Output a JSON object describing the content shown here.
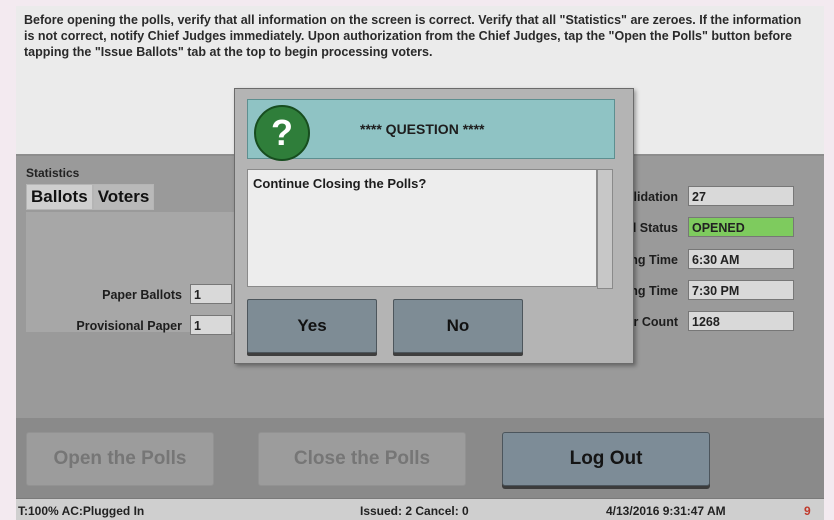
{
  "instructions": "Before opening the polls, verify that all information on the screen is correct. Verify that all \"Statistics\" are zeroes. If the information is not correct, notify Chief Judges immediately. Upon authorization from the Chief Judges, tap the \"Open the Polls\" button before tapping the \"Issue Ballots\" tab at the top to begin processing voters.",
  "statistics": {
    "label": "Statistics",
    "tabs": [
      "Ballots",
      "Voters"
    ],
    "fields": [
      {
        "label": "Paper Ballots",
        "value": "1"
      },
      {
        "label": "Provisional Paper",
        "value": "1"
      }
    ]
  },
  "right_fields": [
    {
      "label": "olidation",
      "value": "27"
    },
    {
      "label": "oll Status",
      "value": "OPENED"
    },
    {
      "label": "ing Time",
      "value": "6:30 AM"
    },
    {
      "label": "ing Time",
      "value": "7:30 PM"
    },
    {
      "label": "er Count",
      "value": "1268"
    }
  ],
  "dialog": {
    "title": "**** QUESTION ****",
    "message": "Continue Closing the Polls?",
    "yes_label": "Yes",
    "no_label": "No",
    "icon": "question-icon"
  },
  "buttons": {
    "open_polls": "Open the Polls",
    "close_polls": "Close the Polls",
    "log_out": "Log Out"
  },
  "status_bar": {
    "battery": "T:100% AC:Plugged In",
    "issued": "Issued: 2 Cancel: 0",
    "datetime": "4/13/2016 9:31:47 AM",
    "corner": "9"
  },
  "colors": {
    "status_opened": "#7ecb5e",
    "dialog_header": "#8fc3c4",
    "question_icon": "#2f7e3a"
  }
}
